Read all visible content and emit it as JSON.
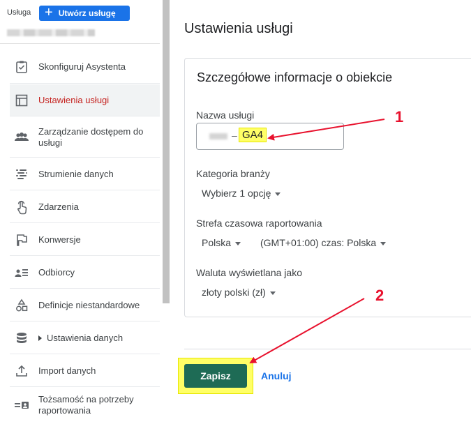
{
  "sidebar": {
    "header_label": "Usługa",
    "create_button_label": "Utwórz usługę",
    "items": [
      {
        "label": "Skonfiguruj Asystenta",
        "icon": "checklist-icon"
      },
      {
        "label": "Ustawienia usługi",
        "icon": "layout-icon",
        "active": true
      },
      {
        "label": "Zarządzanie dostępem do usługi",
        "icon": "people-icon"
      },
      {
        "label": "Strumienie danych",
        "icon": "streams-icon"
      },
      {
        "label": "Zdarzenia",
        "icon": "touch-icon"
      },
      {
        "label": "Konwersje",
        "icon": "flag-icon"
      },
      {
        "label": "Odbiorcy",
        "icon": "audience-icon"
      },
      {
        "label": "Definicje niestandardowe",
        "icon": "shapes-icon"
      },
      {
        "label": "Ustawienia danych",
        "icon": "database-icon",
        "expandable": true
      },
      {
        "label": "Import danych",
        "icon": "upload-icon"
      },
      {
        "label": "Tożsamość na potrzeby raportowania",
        "icon": "id-card-icon"
      }
    ]
  },
  "main": {
    "page_title": "Ustawienia usługi",
    "card_title": "Szczegółowe informacje o obiekcie",
    "property_name": {
      "label": "Nazwa usługi",
      "separator": "–",
      "highlighted_value": "GA4"
    },
    "industry": {
      "label": "Kategoria branży",
      "value": "Wybierz 1 opcję"
    },
    "timezone": {
      "label": "Strefa czasowa raportowania",
      "country": "Polska",
      "zone": "(GMT+01:00) czas: Polska"
    },
    "currency": {
      "label": "Waluta wyświetlana jako",
      "value": "złoty polski (zł)"
    },
    "save_label": "Zapisz",
    "cancel_label": "Anuluj"
  },
  "annotations": {
    "num1": "1",
    "num2": "2",
    "color": "#e8112d",
    "highlight_color": "#ffff66"
  },
  "colors": {
    "accent": "#1a73e8",
    "save_button": "#1e6b55",
    "active_nav_text": "#c5221f"
  }
}
